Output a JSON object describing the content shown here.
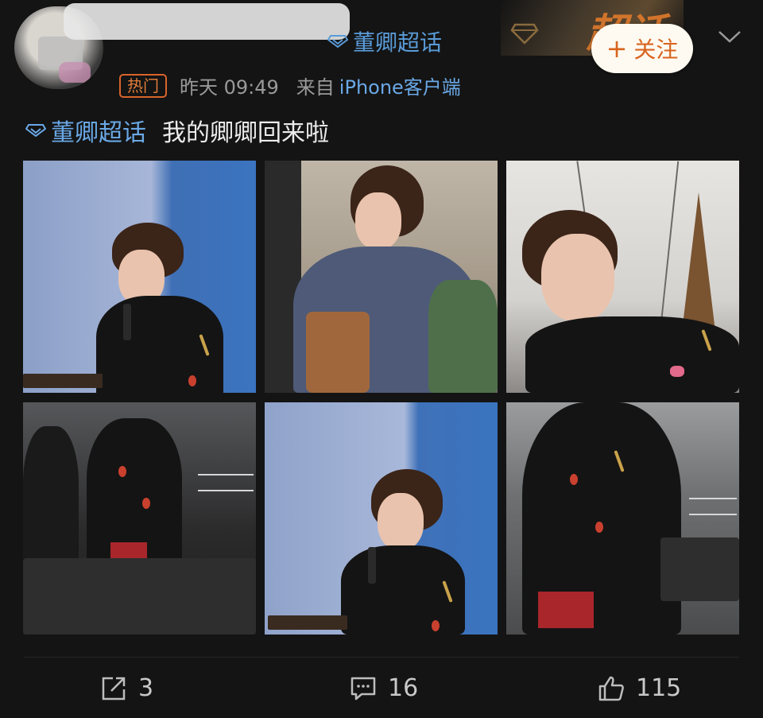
{
  "header": {
    "supertopic_label": "董卿超话",
    "follow_button": "关注",
    "follow_plus": "+",
    "badge_text": "超话",
    "icons": {
      "gem": "gem-icon",
      "chevron": "chevron-down-icon",
      "diamond": "diamond-icon"
    }
  },
  "meta": {
    "hot_label": "热门",
    "time": "昨天 09:49",
    "from": "来自",
    "device": "iPhone客户端"
  },
  "post": {
    "topic": "董卿超话",
    "text": "我的卿卿回来啦"
  },
  "photos": [
    {
      "name": "photo-1"
    },
    {
      "name": "photo-2"
    },
    {
      "name": "photo-3"
    },
    {
      "name": "photo-4"
    },
    {
      "name": "photo-5"
    },
    {
      "name": "photo-6"
    }
  ],
  "actions": {
    "forward_count": "3",
    "comment_count": "16",
    "like_count": "115",
    "icons": {
      "forward": "share-icon",
      "comment": "comment-icon",
      "like": "thumbs-up-icon"
    }
  },
  "colors": {
    "background": "#141414",
    "link": "#6aa8e6",
    "accent": "#d8641f",
    "hot_badge": "#d8642a"
  }
}
